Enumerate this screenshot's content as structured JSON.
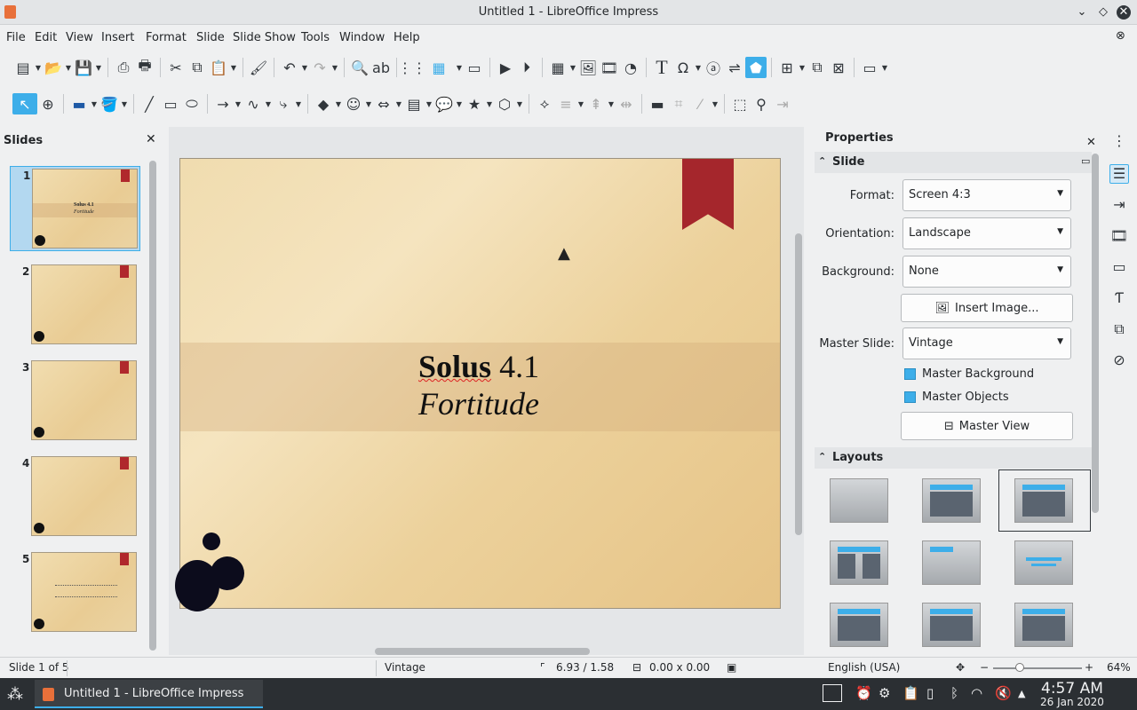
{
  "window": {
    "title": "Untitled 1 - LibreOffice Impress"
  },
  "menu": [
    "File",
    "Edit",
    "View",
    "Insert",
    "Format",
    "Slide",
    "Slide Show",
    "Tools",
    "Window",
    "Help"
  ],
  "slides_panel": {
    "title": "Slides",
    "thumbs": [
      {
        "num": "1",
        "title": "Solus 4.1",
        "subtitle": "Fortitude"
      },
      {
        "num": "2"
      },
      {
        "num": "3"
      },
      {
        "num": "4"
      },
      {
        "num": "5"
      }
    ]
  },
  "slide": {
    "title_bold": "Solus",
    "title_rest": "4.1",
    "subtitle": "Fortitude"
  },
  "properties": {
    "title": "Properties",
    "slide_section": "Slide",
    "format_label": "Format:",
    "format_value": "Screen 4:3",
    "orientation_label": "Orientation:",
    "orientation_value": "Landscape",
    "background_label": "Background:",
    "background_value": "None",
    "insert_image": "Insert Image...",
    "master_label": "Master Slide:",
    "master_value": "Vintage",
    "master_background": "Master Background",
    "master_objects": "Master Objects",
    "master_view": "Master View",
    "layouts_section": "Layouts"
  },
  "status": {
    "slide": "Slide 1 of 5",
    "master": "Vintage",
    "position": "6.93 / 1.58",
    "size": "0.00 x 0.00",
    "language": "English (USA)",
    "zoom": "64%"
  },
  "taskbar": {
    "task": "Untitled 1 - LibreOffice Impress",
    "time": "4:57 AM",
    "date": "26 Jan 2020"
  },
  "colors": {
    "accent": "#3daee9",
    "ribbon": "#a5262c"
  }
}
